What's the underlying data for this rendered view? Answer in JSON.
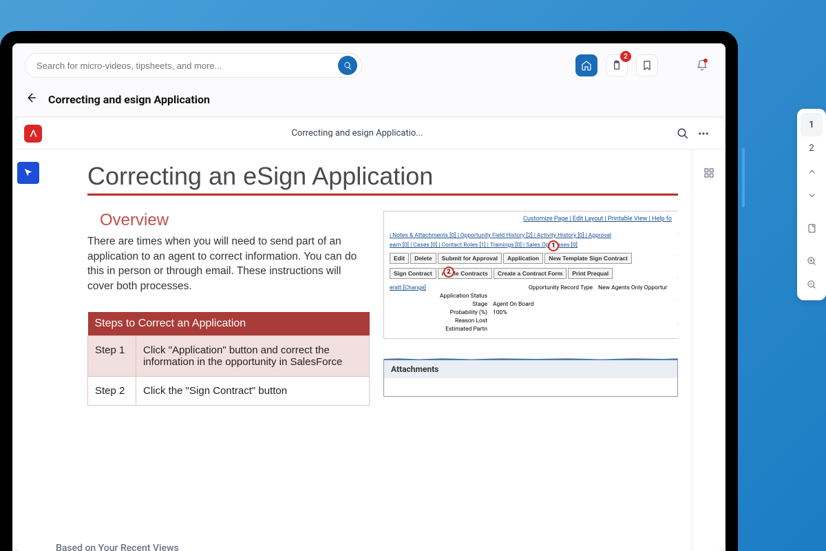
{
  "search": {
    "placeholder": "Search for micro-videos, tipsheets, and more..."
  },
  "topbar": {
    "clipboard_badge": "2"
  },
  "page": {
    "title": "Correcting and esign Application"
  },
  "pdf": {
    "header_title": "Correcting and esign Applicatio..."
  },
  "doc": {
    "h1": "Correcting an eSign Application",
    "overview_heading": "Overview",
    "overview_text": "There are times when you will need to send part of an application to an agent to correct information.  You can do this in person or through email.  These instructions will cover both processes.",
    "steps_header": "Steps  to Correct an Application",
    "steps": [
      {
        "num": "Step 1",
        "text": "Click \"Application\" button and correct the information in the opportunity in SalesForce"
      },
      {
        "num": "Step 2",
        "text": "Click the \"Sign Contract\" button"
      }
    ]
  },
  "salesforce": {
    "top_links": "Customize Page | Edit Layout | Printable View | Help fo",
    "nav1": "|  Notes & Attachments [0]  |  Opportunity Field History [2]  |  Activity History [0]  |  Approval",
    "nav2": "eam [0]  |  Cases [0]  |  Contact Roles [1]  |  Trainings [0]  |  Sales Ops Cases [0]",
    "buttons_row1": [
      "Edit",
      "Delete",
      "Submit for Approval",
      "Application",
      "New Template Sign Contract"
    ],
    "buttons_row2": [
      "Sign Contract",
      "ntable Contracts",
      "Create a Contract Form",
      "Print Prequal"
    ],
    "annot1": "1",
    "annot2": "2",
    "change_link": "eratt [Change]",
    "fields": [
      {
        "label": "Opportunity Record Type",
        "value": "New Agents Only Opportunit"
      },
      {
        "label": "Application Status",
        "value": ""
      },
      {
        "label": "Stage",
        "value": "Agent On Board"
      },
      {
        "label": "Probability (%)",
        "value": "100%"
      },
      {
        "label": "Reason Lost",
        "value": ""
      },
      {
        "label": "Estimated Partn",
        "value": ""
      }
    ],
    "attachments_heading": "Attachments"
  },
  "pager": {
    "page1": "1",
    "page2": "2"
  },
  "footer": {
    "recent": "Based on Your Recent Views"
  }
}
